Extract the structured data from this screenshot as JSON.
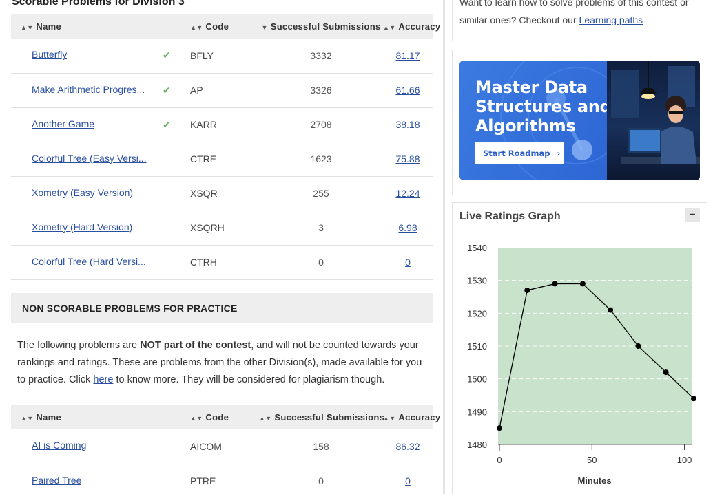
{
  "scorable": {
    "title": "Scorable Problems for Division 3",
    "headers": {
      "name": "Name",
      "code": "Code",
      "subs": "Successful Submissions",
      "acc": "Accuracy"
    },
    "rows": [
      {
        "name": "Butterfly",
        "solved": true,
        "code": "BFLY",
        "subs": "3332",
        "acc": "81.17"
      },
      {
        "name": "Make Arithmetic Progres...",
        "solved": true,
        "code": "AP",
        "subs": "3326",
        "acc": "61.66"
      },
      {
        "name": "Another Game",
        "solved": true,
        "code": "KARR",
        "subs": "2708",
        "acc": "38.18"
      },
      {
        "name": "Colorful Tree (Easy Versi...",
        "solved": false,
        "code": "CTRE",
        "subs": "1623",
        "acc": "75.88"
      },
      {
        "name": "Xometry (Easy Version)",
        "solved": false,
        "code": "XSQR",
        "subs": "255",
        "acc": "12.24"
      },
      {
        "name": "Xometry (Hard Version)",
        "solved": false,
        "code": "XSQRH",
        "subs": "3",
        "acc": "6.98"
      },
      {
        "name": "Colorful Tree (Hard Versi...",
        "solved": false,
        "code": "CTRH",
        "subs": "0",
        "acc": "0"
      }
    ]
  },
  "non_scorable": {
    "title": "NON SCORABLE PROBLEMS FOR PRACTICE",
    "text_1": "The following problems are ",
    "text_bold": "NOT part of the contest",
    "text_2": ", and will not be counted towards your rankings and ratings. These are problems from the other Division(s), made available for you to practice. Click ",
    "link": "here",
    "text_3": " to know more. They will be considered for plagiarism though.",
    "headers": {
      "name": "Name",
      "code": "Code",
      "subs": "Successful Submissions",
      "acc": "Accuracy"
    },
    "rows": [
      {
        "name": "AI is Coming",
        "code": "AICOM",
        "subs": "158",
        "acc": "86.32"
      },
      {
        "name": "Paired Tree",
        "code": "PTRE",
        "subs": "0",
        "acc": "0"
      }
    ]
  },
  "sidebar": {
    "promo_text_1": "Want to learn how to solve problems of this contest or similar ones? Checkout our ",
    "promo_link": "Learning paths",
    "banner_title_1": "Master Data",
    "banner_title_2": "Structures and",
    "banner_title_3": "Algorithms",
    "banner_button": "Start Roadmap",
    "graph_title": "Live Ratings Graph",
    "collapse_symbol": "−"
  },
  "colors": {
    "link": "#2a4fa0",
    "check": "#6bb36b",
    "graph_bg": "#c9e2cc",
    "banner": "#2f69d6"
  },
  "chart_data": {
    "type": "line",
    "title": "Live Ratings Graph",
    "xlabel": "Minutes",
    "ylabel": "",
    "xlim": [
      0,
      105
    ],
    "ylim": [
      1480,
      1540
    ],
    "xticks": [
      0,
      50,
      100
    ],
    "yticks": [
      1480,
      1490,
      1500,
      1510,
      1520,
      1530,
      1540
    ],
    "x": [
      0,
      15,
      30,
      45,
      60,
      75,
      90,
      105
    ],
    "y": [
      1485,
      1527,
      1529,
      1529,
      1521,
      1510,
      1502,
      1494
    ],
    "grid": true
  }
}
